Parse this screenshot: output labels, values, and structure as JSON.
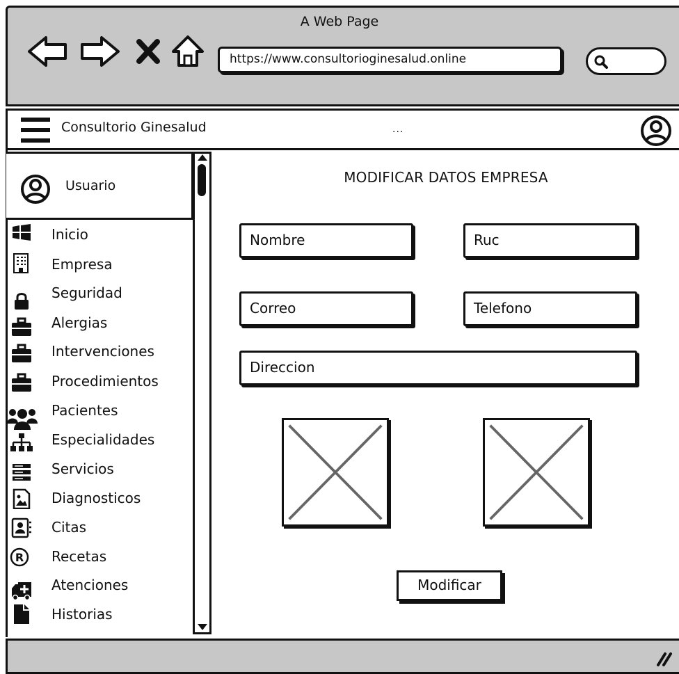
{
  "browser": {
    "window_title": "A Web Page",
    "url": "https://www.consultorioginesalud.online",
    "icons": [
      "back-arrow-icon",
      "forward-arrow-icon",
      "close-icon",
      "home-icon",
      "search-icon"
    ]
  },
  "app_bar": {
    "title": "Consultorio Ginesalud",
    "ellipsis": "...",
    "icons": [
      "hamburger-menu-icon",
      "user-account-icon"
    ]
  },
  "sidebar": {
    "user_label": "Usuario",
    "items": [
      {
        "label": "Inicio",
        "icon": "windows-icon"
      },
      {
        "label": "Empresa",
        "icon": "building-icon"
      },
      {
        "label": "Seguridad",
        "icon": "lock-icon"
      },
      {
        "label": "Alergias",
        "icon": "briefcase-icon"
      },
      {
        "label": "Intervenciones",
        "icon": "briefcase-icon"
      },
      {
        "label": "Procedimientos",
        "icon": "briefcase-icon"
      },
      {
        "label": "Pacientes",
        "icon": "people-icon"
      },
      {
        "label": "Especialidades",
        "icon": "sitemap-icon"
      },
      {
        "label": "Servicios",
        "icon": "server-icon"
      },
      {
        "label": "Diagnosticos",
        "icon": "image-file-icon"
      },
      {
        "label": "Citas",
        "icon": "contact-book-icon"
      },
      {
        "label": "Recetas",
        "icon": "registered-icon"
      },
      {
        "label": "Atenciones",
        "icon": "ambulance-icon"
      },
      {
        "label": "Historias",
        "icon": "file-icon"
      }
    ]
  },
  "main": {
    "title": "MODIFICAR DATOS EMPRESA",
    "fields": {
      "nombre": "Nombre",
      "ruc": "Ruc",
      "correo": "Correo",
      "telefono": "Telefono",
      "direccion": "Direccion"
    },
    "submit_label": "Modificar"
  }
}
